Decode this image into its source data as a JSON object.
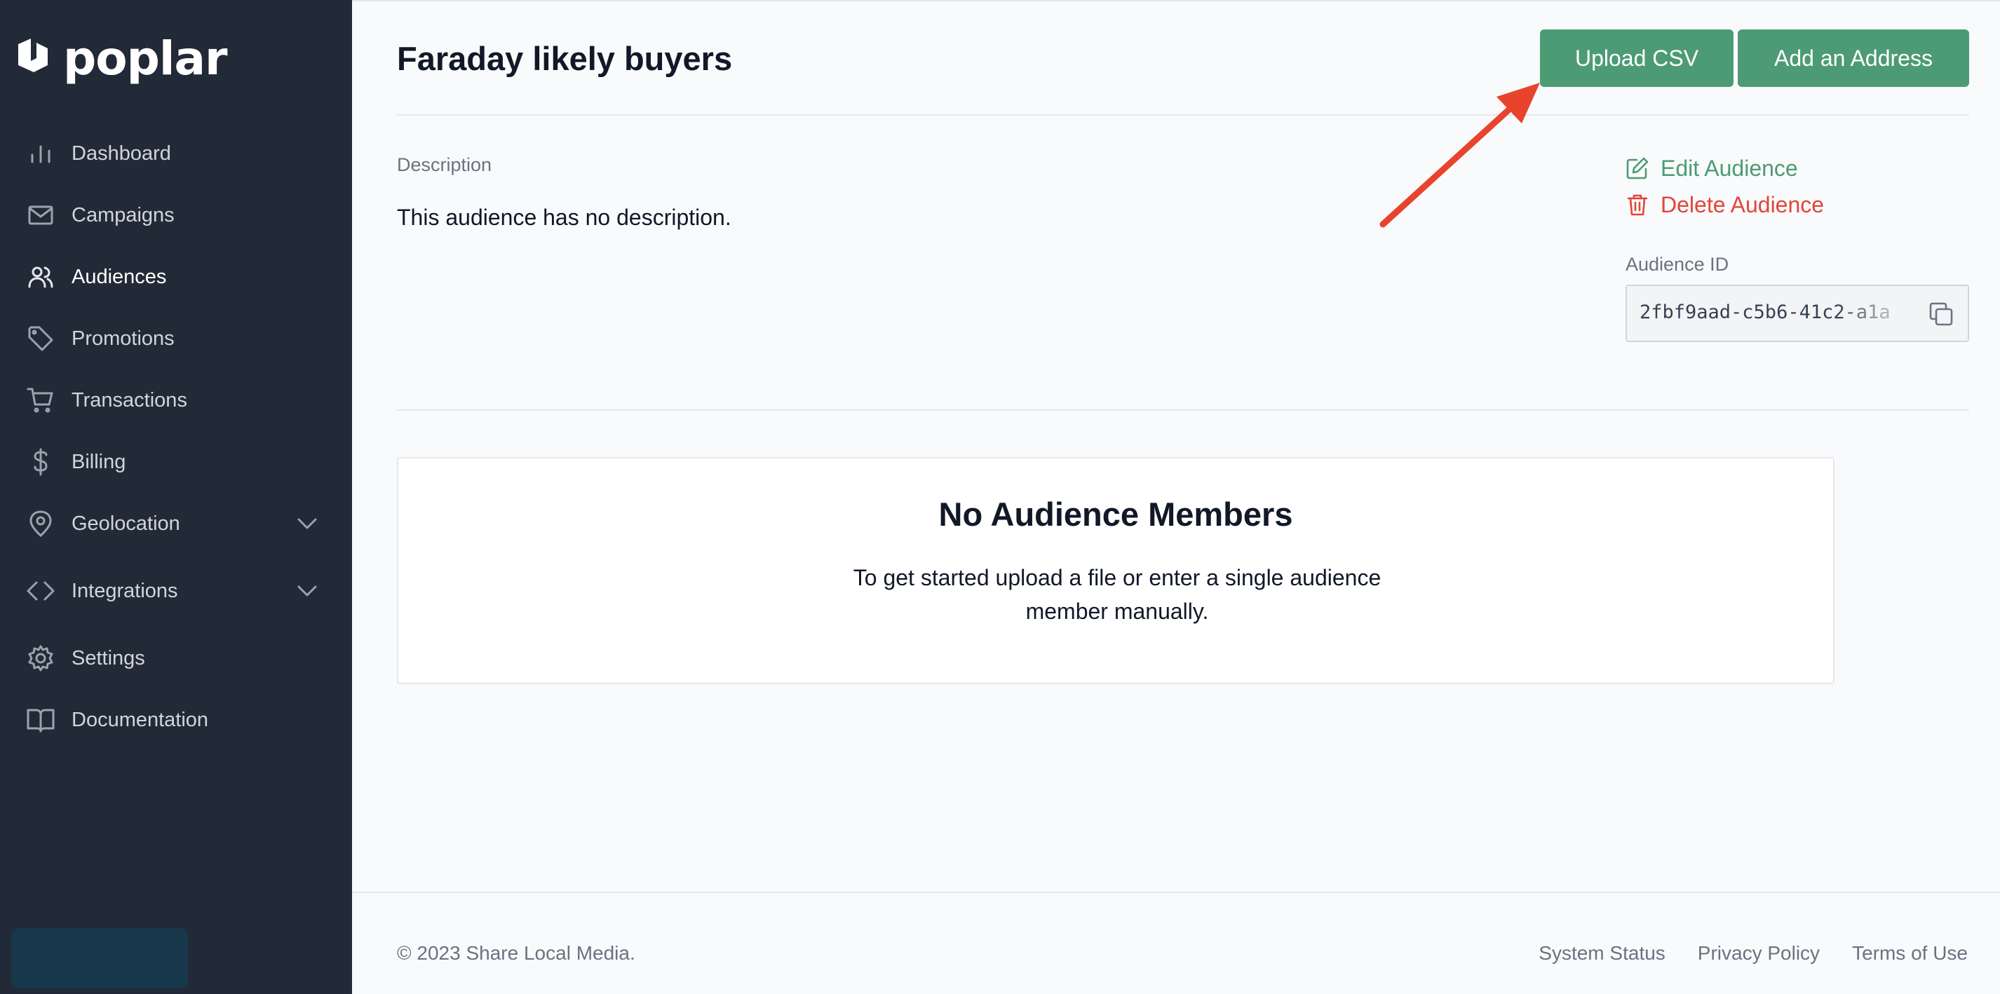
{
  "brand": {
    "name": "poplar"
  },
  "sidebar": {
    "items": [
      {
        "label": "Dashboard",
        "icon": "bar-chart-icon"
      },
      {
        "label": "Campaigns",
        "icon": "mail-icon"
      },
      {
        "label": "Audiences",
        "icon": "users-icon",
        "active": true
      },
      {
        "label": "Promotions",
        "icon": "tag-icon"
      },
      {
        "label": "Transactions",
        "icon": "cart-icon"
      },
      {
        "label": "Billing",
        "icon": "dollar-icon"
      },
      {
        "label": "Geolocation",
        "icon": "map-pin-icon",
        "expandable": true
      },
      {
        "label": "Integrations",
        "icon": "code-icon",
        "expandable": true
      },
      {
        "label": "Settings",
        "icon": "gear-icon"
      },
      {
        "label": "Documentation",
        "icon": "book-icon"
      }
    ]
  },
  "header": {
    "title": "Faraday likely buyers",
    "upload_label": "Upload CSV",
    "add_label": "Add an Address"
  },
  "details": {
    "description_label": "Description",
    "description_text": "This audience has no description.",
    "edit_label": "Edit Audience",
    "delete_label": "Delete Audience",
    "audience_id_label": "Audience ID",
    "audience_id_value": "2fbf9aad-c5b6-41c2-a1a"
  },
  "empty_state": {
    "title": "No Audience Members",
    "text": "To get started upload a file or enter a single audience member manually."
  },
  "footer": {
    "copyright": "© 2023 Share Local Media.",
    "links": [
      "System Status",
      "Privacy Policy",
      "Terms of Use"
    ]
  },
  "colors": {
    "sidebar_bg": "#222a38",
    "accent_green": "#4d9b75",
    "danger_red": "#e2453b",
    "annotation_arrow": "#e8432d"
  }
}
